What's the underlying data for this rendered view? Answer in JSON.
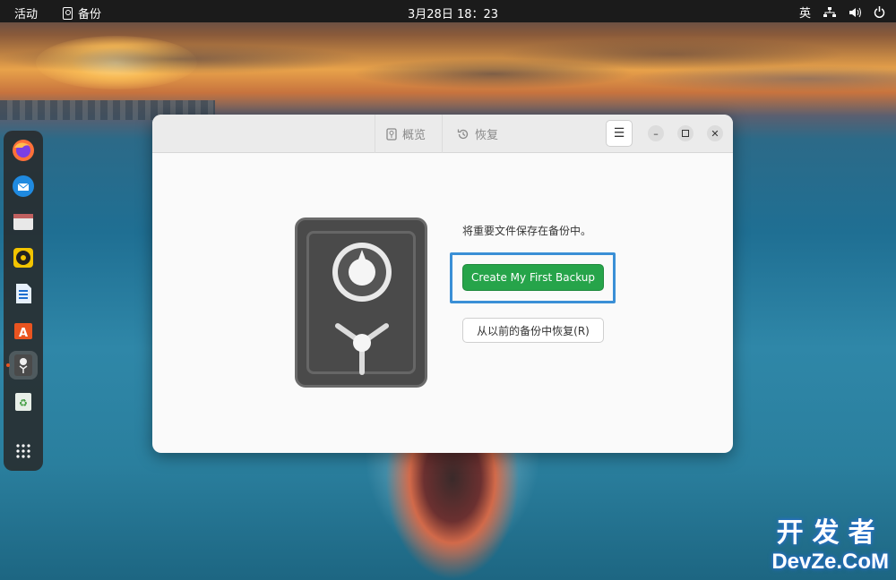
{
  "topbar": {
    "activities": "活动",
    "app_name": "备份",
    "clock": "3月28日  18：23",
    "input_method": "英"
  },
  "dock": {
    "items": [
      "firefox-icon",
      "thunderbird-icon",
      "files-icon",
      "rhythmbox-icon",
      "writer-icon",
      "app-center-icon",
      "backup-icon",
      "trash-icon",
      "show-apps-icon"
    ],
    "active_index": 6
  },
  "window": {
    "tabs": [
      {
        "label": "概览",
        "icon": "safe-icon"
      },
      {
        "label": "恢复",
        "icon": "history-icon"
      }
    ],
    "description": "将重要文件保存在备份中。",
    "primary_button": "Create My First Backup",
    "secondary_button": "从以前的备份中恢复(R)"
  },
  "colors": {
    "accent_green": "#26a44a",
    "highlight_blue": "#3a8fd6"
  },
  "watermark": {
    "line1": "开发者",
    "line2": "DevZe.CoM"
  }
}
